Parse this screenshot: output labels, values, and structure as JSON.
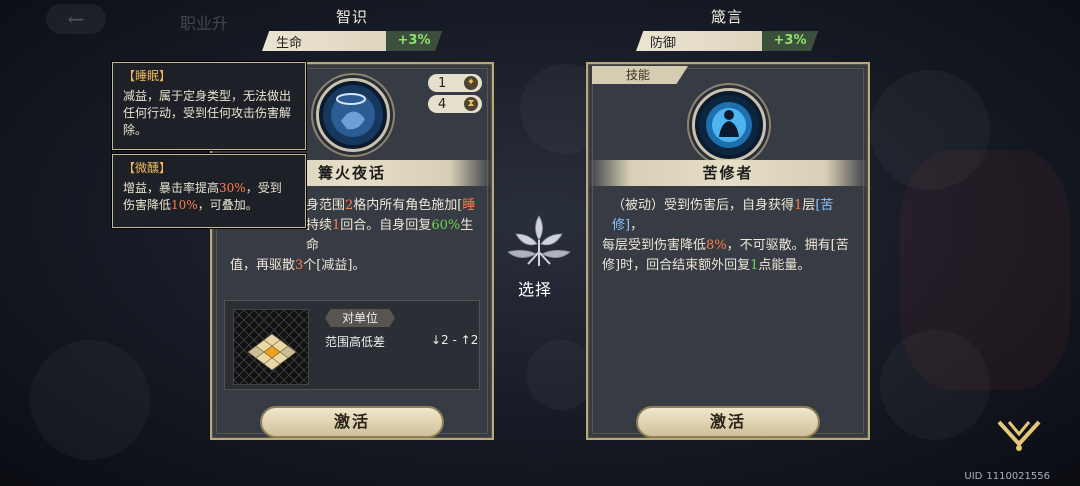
{
  "header": {
    "back_icon": "arrow-left-icon",
    "bg_title": "职业升"
  },
  "left": {
    "stat_name": "智识",
    "stat_label": "生命",
    "stat_value": "+3%",
    "badge_uses": "1",
    "badge_cooldown": "4",
    "skill_name": "篝火夜话",
    "activate_label": "激活",
    "desc_parts": {
      "p1": "身范围",
      "n1": "2",
      "p2": "格内所有角色施加[",
      "status": "睡",
      "p3": "持续",
      "n2": "1",
      "p4": "回合。自身回复",
      "n3": "60%",
      "p5": "生命",
      "p6": "值，再驱散",
      "n4": "3",
      "p7": "个[减益]。"
    },
    "range": {
      "target_label": "对单位",
      "range_label": "范围高低差",
      "range_value": "↓2 - ↑2"
    }
  },
  "right": {
    "stat_name": "箴言",
    "stat_label": "防御",
    "stat_value": "+3%",
    "tag": "技能",
    "skill_name": "苦修者",
    "activate_label": "激活",
    "desc_parts": {
      "p1": "（被动）受到伤害后，自身获得",
      "n1": "1",
      "p2": "层",
      "status1": "[苦修]",
      "p3": "，",
      "p4": "每层受到伤害降低",
      "n2": "8%",
      "p5": "，不可驱散。拥有[苦",
      "p6": "修]时，回合结束额外回复",
      "n3": "1",
      "p7": "点能量。"
    }
  },
  "tooltips": [
    {
      "title": "【睡眠】",
      "lines": [
        "减益，属于定身类型，无法做出",
        "任何行动，受到任何攻击伤害解",
        "除。"
      ]
    },
    {
      "title": "【微醺】",
      "l1a": "增益，暴击率提高",
      "l1n": "30%",
      "l1b": "，受到",
      "l2a": "伤害降低",
      "l2n": "10%",
      "l2b": "，可叠加。"
    }
  ],
  "center": {
    "select_label": "选择"
  },
  "footer": {
    "uid_label": "UID",
    "uid_value": "1110021556"
  },
  "colors": {
    "accent_gold": "#b9a978",
    "positive_green": "#8fe36a",
    "highlight_orange": "#ff7e4a"
  }
}
